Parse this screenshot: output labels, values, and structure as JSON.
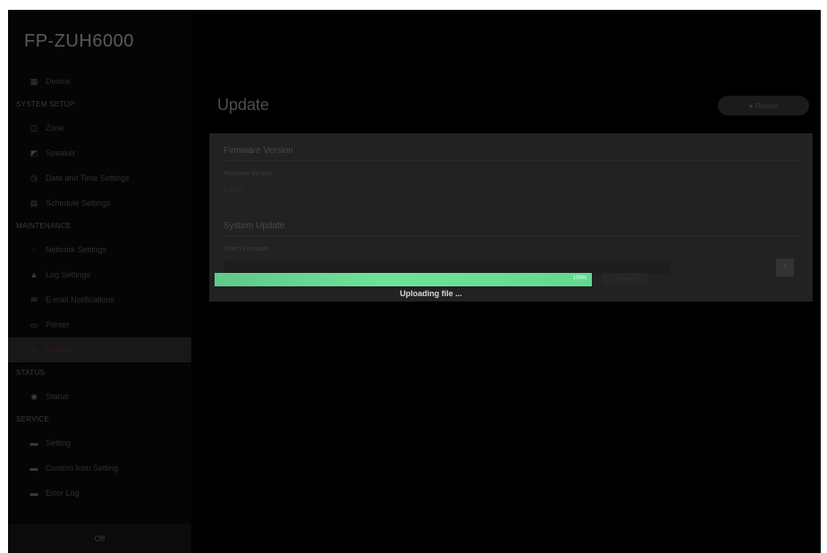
{
  "app": {
    "title": "FP-ZUH6000"
  },
  "sidebar": {
    "top_item": {
      "label": "Device",
      "icon": "grid-icon"
    },
    "sections": [
      {
        "title": "SYSTEM SETUP",
        "items": [
          {
            "label": "Zone",
            "icon": "zone-icon"
          },
          {
            "label": "Speaker",
            "icon": "speaker-icon"
          },
          {
            "label": "Date and Time Settings",
            "icon": "clock-icon"
          },
          {
            "label": "Schedule Settings",
            "icon": "calendar-icon"
          }
        ]
      },
      {
        "title": "MAINTENANCE",
        "items": [
          {
            "label": "Network Settings",
            "icon": "network-icon"
          },
          {
            "label": "Log Settings",
            "icon": "warning-icon"
          },
          {
            "label": "E-mail Notifications",
            "icon": "mail-icon"
          },
          {
            "label": "Printer",
            "icon": "printer-icon"
          },
          {
            "label": "Update",
            "icon": "update-icon",
            "active": true
          }
        ]
      },
      {
        "title": "STATUS",
        "items": [
          {
            "label": "Status",
            "icon": "status-icon"
          }
        ]
      },
      {
        "title": "SERVICE",
        "items": [
          {
            "label": "Setting",
            "icon": "folder-icon"
          },
          {
            "label": "Custom Icon Setting",
            "icon": "folder-icon"
          },
          {
            "label": "Error Log",
            "icon": "folder-icon"
          }
        ]
      }
    ],
    "logout_label": "Off"
  },
  "main": {
    "title": "Update",
    "top_button_label": "● Restart",
    "firmware_section_title": "Firmware Version",
    "firmware_field_label": "Firmware Version",
    "firmware_value": "1.0.0.0",
    "update_section_title": "System Update",
    "update_field_label": "Select Firmware",
    "side_button_label": "↑",
    "small_button_label": "Update"
  },
  "progress": {
    "percent": 100,
    "percent_label": "100%",
    "status_text": "Uploading file ..."
  }
}
